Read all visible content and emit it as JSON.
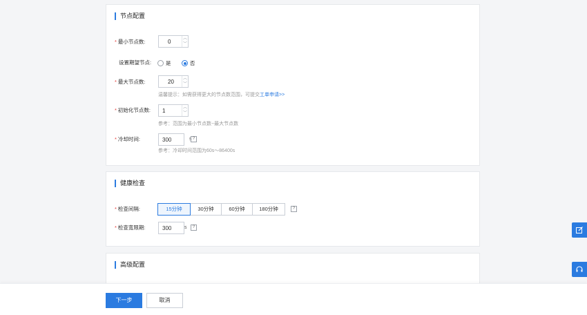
{
  "node_config": {
    "title": "节点配置",
    "min_nodes": {
      "label": "最小节点数:",
      "value": "0"
    },
    "expect_nodes": {
      "label": "设置期望节点:",
      "options": [
        "是",
        "否"
      ],
      "selected": "否"
    },
    "max_nodes": {
      "label": "最大节点数:",
      "value": "20",
      "hint_prefix": "温馨提示：如需获得更大的节点数范围，可提交",
      "hint_link": "工单申请>>"
    },
    "init_nodes": {
      "label": "初始化节点数:",
      "value": "1",
      "hint": "参考：范围为最小节点数~最大节点数"
    },
    "cooldown": {
      "label": "冷却时间:",
      "value": "300",
      "unit": "s",
      "help": "?",
      "hint": "参考：冷却时间范围为60s～86400s"
    }
  },
  "health_check": {
    "title": "健康检查",
    "interval": {
      "label": "检查间隔:",
      "options": [
        "15分钟",
        "30分钟",
        "60分钟",
        "180分钟"
      ],
      "selected": "15分钟",
      "help": "?"
    },
    "grace": {
      "label": "检查宽限期:",
      "value": "300",
      "unit": "s",
      "help": "?"
    }
  },
  "advanced": {
    "title": "高级配置"
  },
  "footer": {
    "next": "下一步",
    "cancel": "取消"
  },
  "side_tools": [
    "edit-icon",
    "headset-icon"
  ],
  "colors": {
    "accent": "#2b7be0",
    "required": "#e53935"
  }
}
